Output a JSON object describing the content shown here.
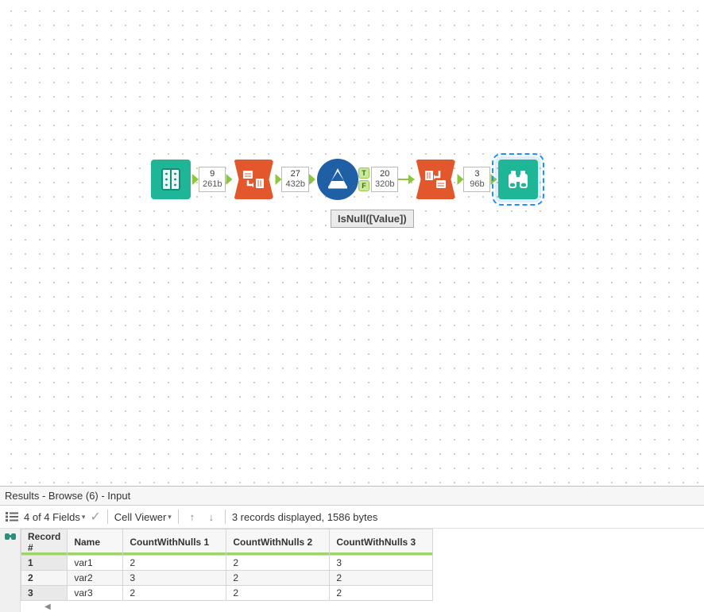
{
  "canvas": {
    "tools": {
      "input": {
        "name": "text-input-tool"
      },
      "transpose1": {
        "name": "transpose-tool"
      },
      "filter": {
        "name": "filter-tool",
        "annotation": "IsNull([Value])"
      },
      "transpose2": {
        "name": "crosstab-tool"
      },
      "browse": {
        "name": "browse-tool"
      }
    },
    "conn": {
      "c1": {
        "records": "9",
        "bytes": "261b"
      },
      "c2": {
        "records": "27",
        "bytes": "432b"
      },
      "c3t": {
        "records": "20",
        "bytes": "320b"
      },
      "c4": {
        "records": "3",
        "bytes": "96b"
      }
    },
    "tf": {
      "t": "T",
      "f": "F"
    }
  },
  "results": {
    "title": "Results - Browse (6) - Input",
    "fieldsLabel": "4 of 4 Fields",
    "cellViewerLabel": "Cell Viewer",
    "statusText": "3 records displayed, 1586 bytes",
    "columns": {
      "c0": "Record #",
      "c1": "Name",
      "c2": "CountWithNulls 1",
      "c3": "CountWithNulls 2",
      "c4": "CountWithNulls 3"
    },
    "rows": [
      {
        "n": "1",
        "name": "var1",
        "v1": "2",
        "v2": "2",
        "v3": "3"
      },
      {
        "n": "2",
        "name": "var2",
        "v1": "3",
        "v2": "2",
        "v3": "2"
      },
      {
        "n": "3",
        "name": "var3",
        "v1": "2",
        "v2": "2",
        "v3": "2"
      }
    ]
  }
}
